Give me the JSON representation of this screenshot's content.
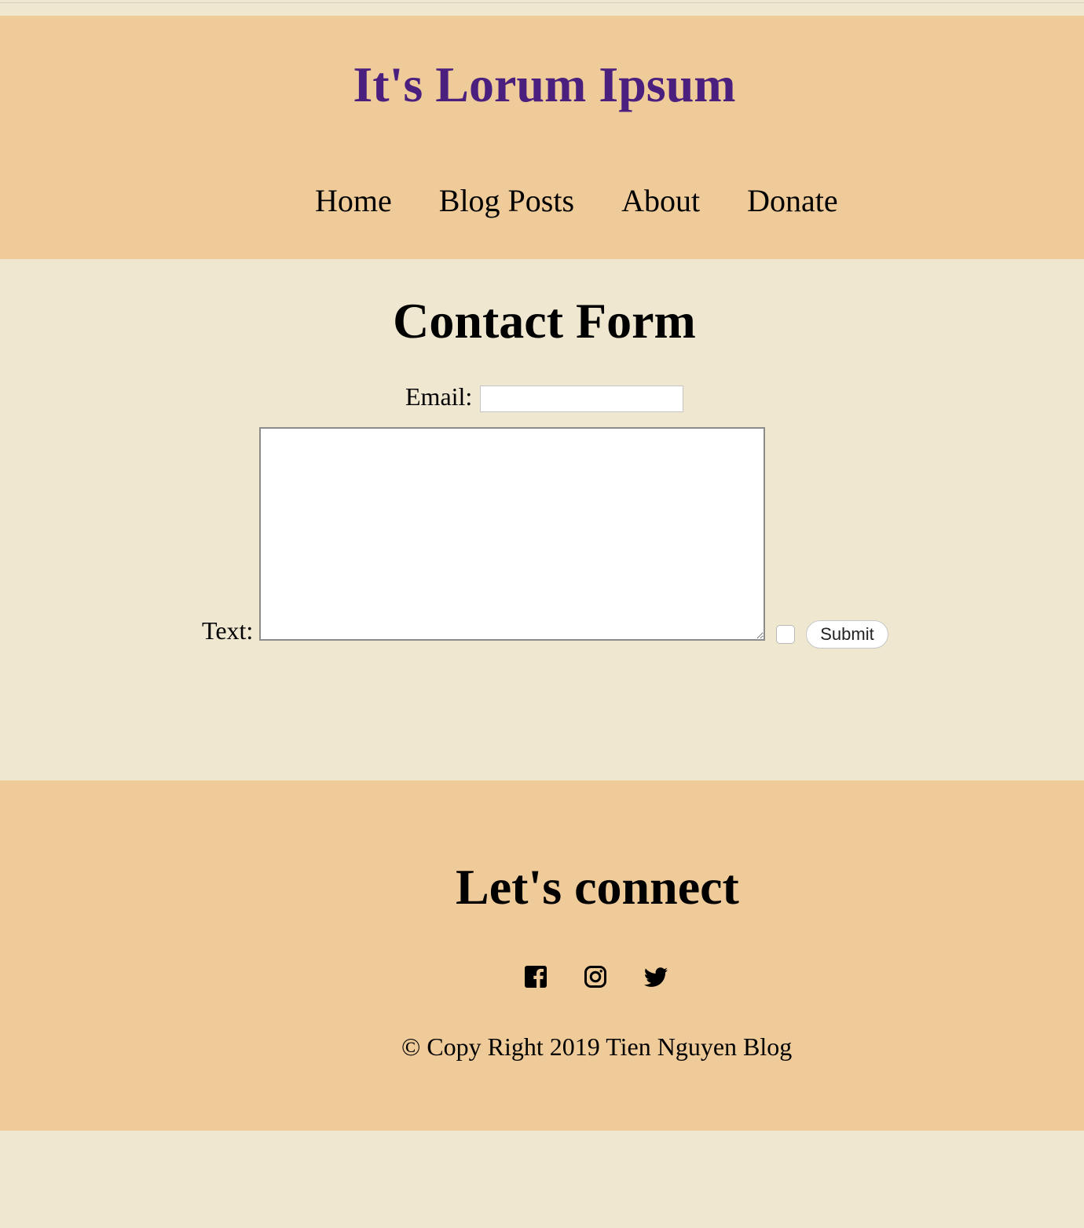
{
  "header": {
    "title": "It's Lorum Ipsum",
    "nav": [
      "Home",
      "Blog Posts",
      "About",
      "Donate"
    ]
  },
  "contact": {
    "title": "Contact Form",
    "email_label": "Email:",
    "email_value": "",
    "text_label": "Text:",
    "text_value": "",
    "checkbox_checked": false,
    "submit_label": "Submit"
  },
  "footer": {
    "connect_title": "Let's connect",
    "social_icons": [
      "facebook-icon",
      "instagram-icon",
      "twitter-icon"
    ],
    "copyright": "© Copy Right 2019 Tien Nguyen Blog"
  },
  "colors": {
    "page_background": "#efe7d0",
    "band_background": "#f0cb9a",
    "title_color": "#4a1f7e"
  }
}
